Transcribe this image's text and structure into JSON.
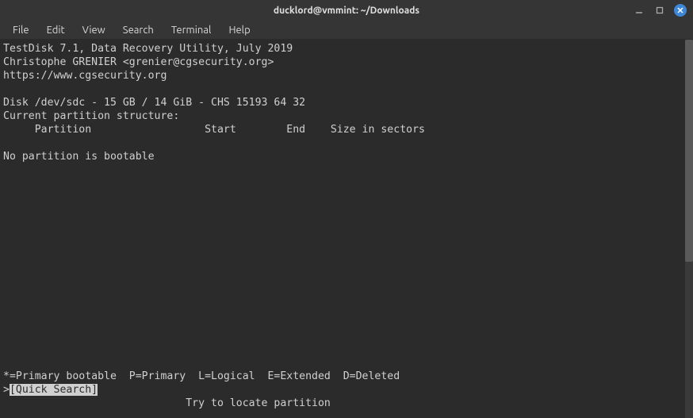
{
  "window": {
    "title": "ducklord@vmmint: ~/Downloads"
  },
  "menubar": {
    "items": [
      "File",
      "Edit",
      "View",
      "Search",
      "Terminal",
      "Help"
    ]
  },
  "terminal": {
    "header": {
      "app_line": "TestDisk 7.1, Data Recovery Utility, July 2019",
      "author_line": "Christophe GRENIER <grenier@cgsecurity.org>",
      "url_line": "https://www.cgsecurity.org"
    },
    "disk_line": "Disk /dev/sdc - 15 GB / 14 GiB - CHS 15193 64 32",
    "structure_line": "Current partition structure:",
    "columns_line": "     Partition                  Start        End    Size in sectors",
    "status_line": "No partition is bootable",
    "legend_line": "*=Primary bootable  P=Primary  L=Logical  E=Extended  D=Deleted",
    "prompt_prefix": ">",
    "selected_option": "[Quick Search]",
    "hint_line": "                             Try to locate partition"
  }
}
